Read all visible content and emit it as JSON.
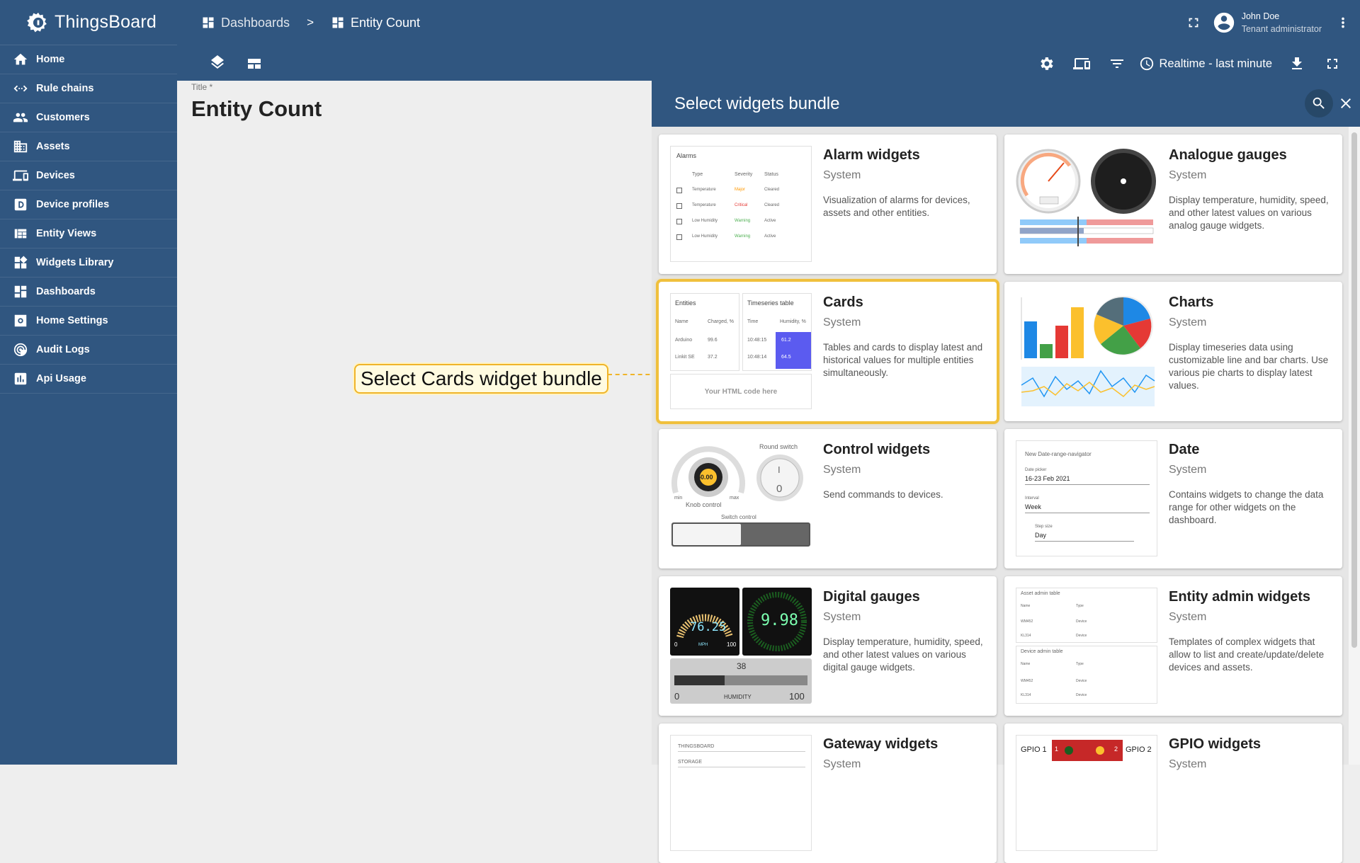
{
  "app": {
    "name": "ThingsBoard"
  },
  "sidebar": {
    "items": [
      {
        "label": "Home",
        "icon": "home-icon"
      },
      {
        "label": "Rule chains",
        "icon": "rule-chain-icon"
      },
      {
        "label": "Customers",
        "icon": "customers-icon"
      },
      {
        "label": "Assets",
        "icon": "assets-icon"
      },
      {
        "label": "Devices",
        "icon": "devices-icon"
      },
      {
        "label": "Device profiles",
        "icon": "device-profile-icon"
      },
      {
        "label": "Entity Views",
        "icon": "entity-views-icon"
      },
      {
        "label": "Widgets Library",
        "icon": "widgets-icon"
      },
      {
        "label": "Dashboards",
        "icon": "dashboards-icon"
      },
      {
        "label": "Home Settings",
        "icon": "settings-icon"
      },
      {
        "label": "Audit Logs",
        "icon": "audit-icon"
      },
      {
        "label": "Api Usage",
        "icon": "chart-icon"
      }
    ]
  },
  "breadcrumb": {
    "items": [
      "Dashboards",
      "Entity Count"
    ],
    "separator": ">"
  },
  "user": {
    "name": "John Doe",
    "role": "Tenant administrator"
  },
  "toolbar": {
    "timewindow": "Realtime - last minute"
  },
  "dashboard": {
    "title_label": "Title *",
    "title": "Entity Count"
  },
  "callout": {
    "text": "Select Cards widget bundle"
  },
  "panel": {
    "title": "Select widgets bundle",
    "bundles": [
      {
        "title": "Alarm widgets",
        "type": "System",
        "desc": "Visualization of alarms for devices, assets and other entities."
      },
      {
        "title": "Analogue gauges",
        "type": "System",
        "desc": "Display temperature, humidity, speed, and other latest values on various analog gauge widgets."
      },
      {
        "title": "Cards",
        "type": "System",
        "desc": "Tables and cards to display latest and historical values for multiple entities simultaneously.",
        "selected": true
      },
      {
        "title": "Charts",
        "type": "System",
        "desc": "Display timeseries data using customizable line and bar charts. Use various pie charts to display latest values."
      },
      {
        "title": "Control widgets",
        "type": "System",
        "desc": "Send commands to devices."
      },
      {
        "title": "Date",
        "type": "System",
        "desc": "Contains widgets to change the data range for other widgets on the dashboard."
      },
      {
        "title": "Digital gauges",
        "type": "System",
        "desc": "Display temperature, humidity, speed, and other latest values on various digital gauge widgets."
      },
      {
        "title": "Entity admin widgets",
        "type": "System",
        "desc": "Templates of complex widgets that allow to list and create/update/delete devices and assets."
      },
      {
        "title": "Gateway widgets",
        "type": "System",
        "desc": ""
      },
      {
        "title": "GPIO widgets",
        "type": "System",
        "desc": ""
      }
    ]
  },
  "previews": {
    "alarm": {
      "title": "Alarms",
      "cols": [
        "Type",
        "Severity",
        "Status"
      ],
      "rows": [
        [
          "Temperature",
          "Major",
          "Cleared"
        ],
        [
          "Temperature",
          "Critical",
          "Cleared"
        ],
        [
          "Low Humidity",
          "Warning",
          "Active"
        ],
        [
          "Low Humidity",
          "Warning",
          "Active"
        ]
      ],
      "severity_colors": [
        "#ff9800",
        "#e53935",
        "#4caf50",
        "#4caf50"
      ]
    },
    "cards": {
      "entities_title": "Entities",
      "entities_cols": [
        "Name",
        "Charged, %"
      ],
      "entities_rows": [
        [
          "Arduino",
          "99.6"
        ],
        [
          "Linkit SE",
          "37.2"
        ]
      ],
      "ts_title": "Timeseries table",
      "ts_cols": [
        "Time",
        "Humidity, %"
      ],
      "ts_rows": [
        [
          "10:48:15",
          "61.2"
        ],
        [
          "10:48:14",
          "64.5"
        ]
      ],
      "html_text": "Your HTML code here"
    },
    "control": {
      "knob_value": "50.00",
      "knob_label": "Knob control",
      "knob_min": "min",
      "knob_max": "max",
      "switch_title": "Round switch",
      "switch_on": "I",
      "switch_off": "0",
      "toggle_label": "Switch control"
    },
    "date": {
      "title": "New Date-range-navigator",
      "picker_label": "Date picker",
      "picker_value": "16-23 Feb 2021",
      "interval_label": "Interval",
      "interval_value": "Week",
      "step_label": "Step size",
      "step_value": "Day"
    },
    "digital": {
      "speed": "76.25",
      "speed_unit": "MPH",
      "speed_min": "0",
      "speed_max": "100",
      "value2": "9.98",
      "hum_value": "38",
      "hum_label": "HUMIDITY",
      "hum_min": "0",
      "hum_max": "100"
    },
    "admin": {
      "asset_title": "Asset admin table",
      "device_title": "Device admin table",
      "cols": [
        "Name",
        "Type"
      ],
      "asset_rows": [
        [
          "WM452",
          "Device"
        ],
        [
          "KL314",
          "Device"
        ]
      ],
      "device_rows": [
        [
          "WM452",
          "Device"
        ],
        [
          "KL314",
          "Device"
        ]
      ]
    },
    "gateway": {
      "row1": "THINGSBOARD",
      "row2": "STORAGE"
    },
    "gpio": {
      "label1": "GPIO 1",
      "label2": "GPIO 2",
      "n1": "1",
      "n2": "2"
    }
  }
}
